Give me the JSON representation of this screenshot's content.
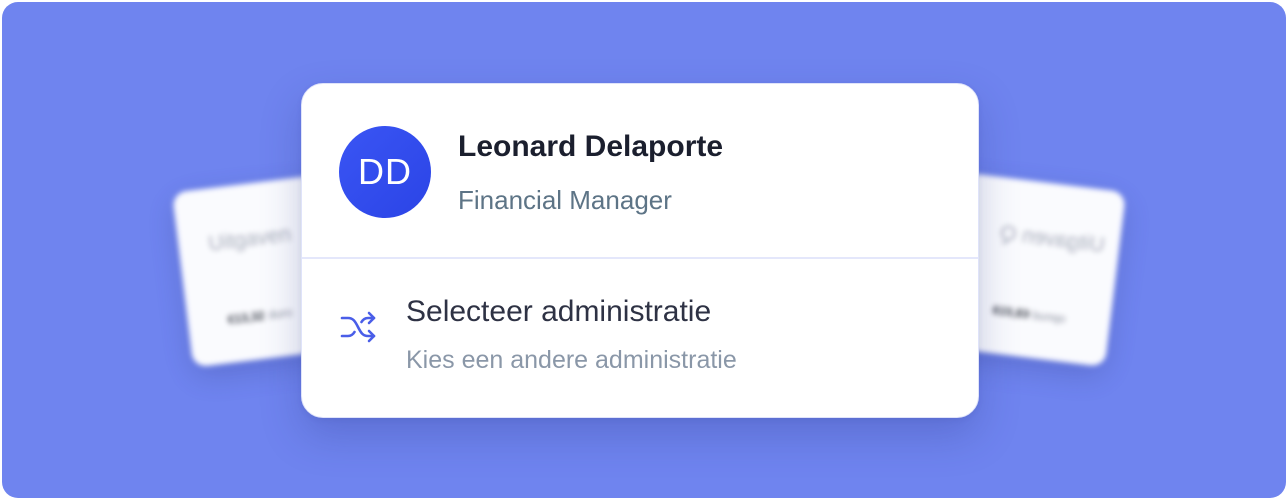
{
  "background_cards": {
    "left": {
      "title": "Uitgaven",
      "amount": "€13,32",
      "amount_suffix": "duro"
    },
    "right": {
      "title": "Uitgaven Q",
      "amount": "€8,019",
      "amount_prefix": "opnud"
    }
  },
  "profile": {
    "initials": "DD",
    "name": "Leonard Delaporte",
    "role": "Financial Manager"
  },
  "switch_administration": {
    "icon": "shuffle-icon",
    "title": "Selecteer administratie",
    "subtitle": "Kies een andere administratie"
  },
  "colors": {
    "background": "#6f84ef",
    "avatar": "#3a55f4",
    "icon": "#4a5ee8"
  }
}
